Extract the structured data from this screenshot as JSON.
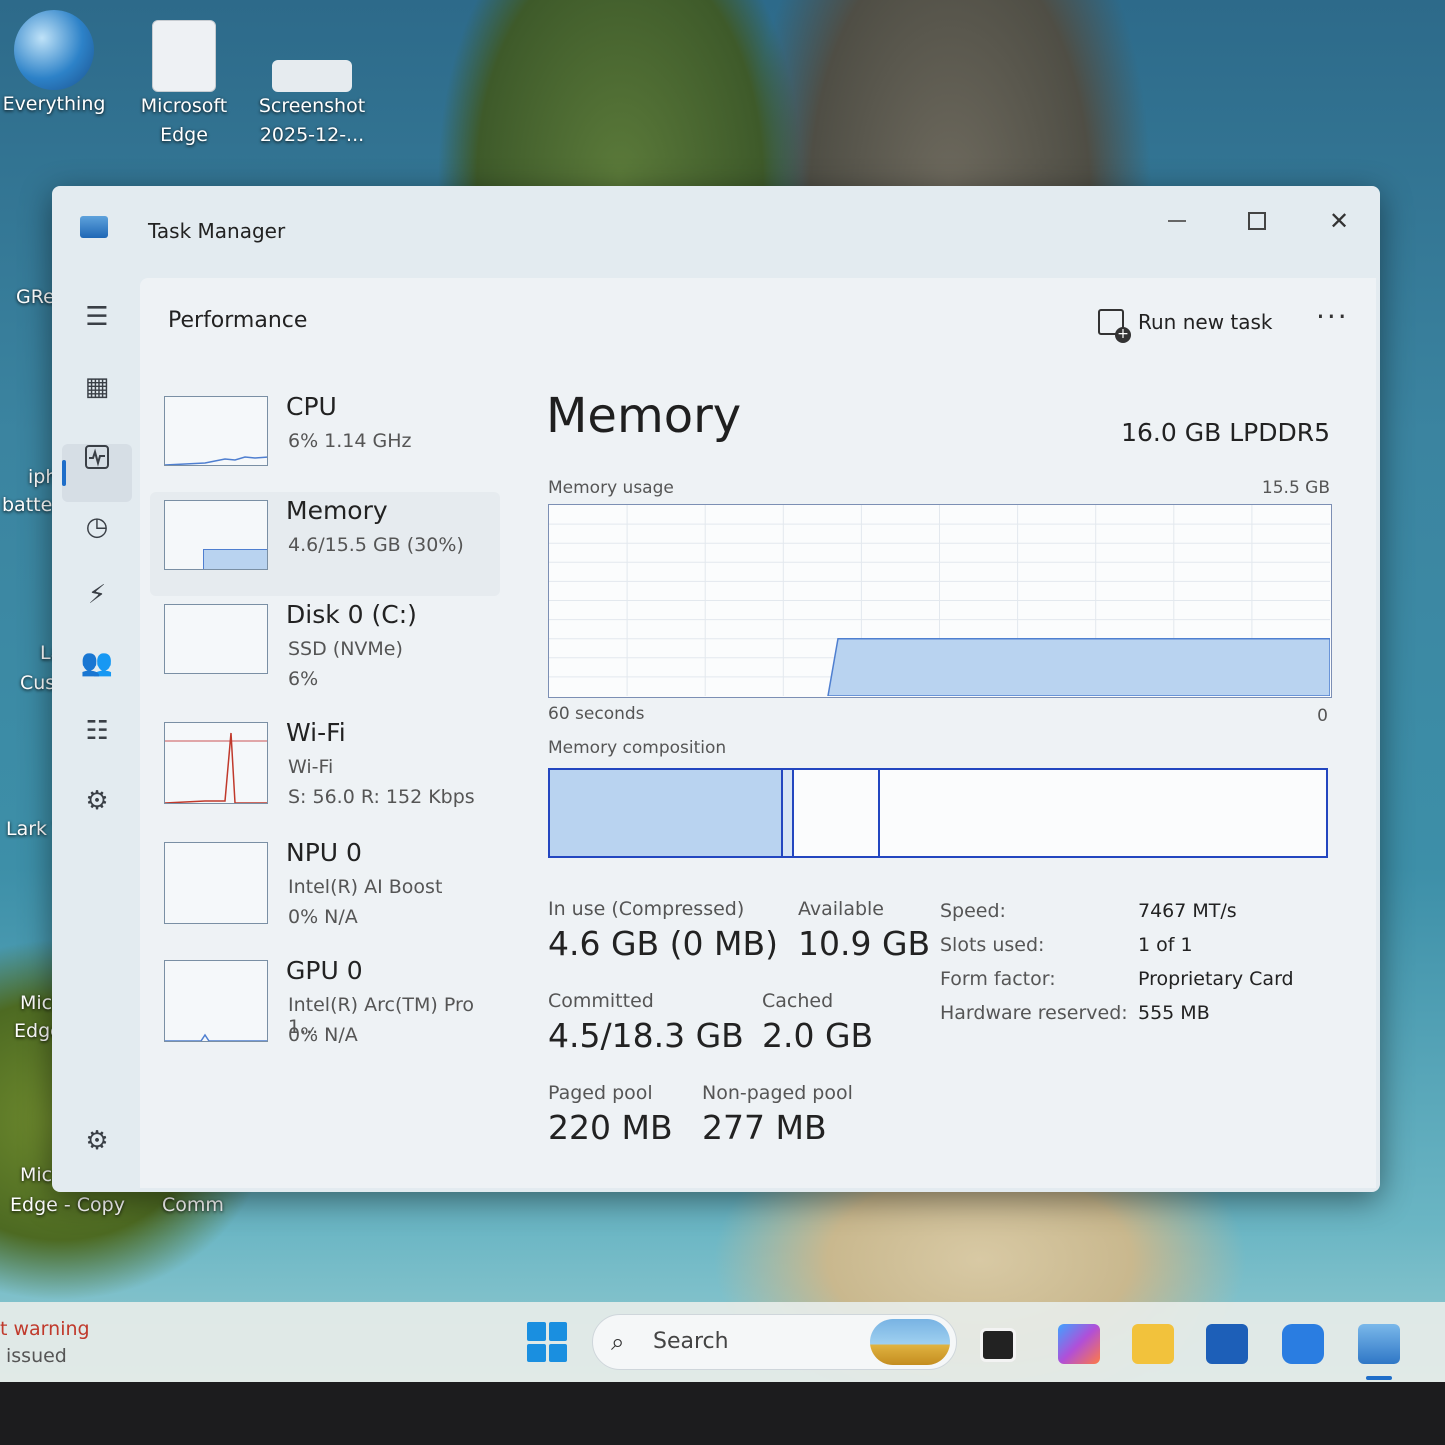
{
  "desktop": {
    "icons": [
      {
        "label": "Everything"
      },
      {
        "label": "Microsoft\nEdge"
      },
      {
        "label": "Screenshot\n2025-12-..."
      }
    ],
    "side_labels": [
      "GRe",
      "iph",
      "batter",
      "La",
      "Cust",
      "Lark T",
      "Micr",
      "Edge",
      "Micr",
      "Edge - Copy",
      "Comm"
    ]
  },
  "window": {
    "title": "Task Manager",
    "header": "Performance",
    "run_new_task": "Run new task",
    "more": "···"
  },
  "devices": [
    {
      "name": "CPU",
      "sub1": "6%  1.14 GHz",
      "sub2": ""
    },
    {
      "name": "Memory",
      "sub1": "4.6/15.5 GB (30%)",
      "sub2": ""
    },
    {
      "name": "Disk 0 (C:)",
      "sub1": "SSD (NVMe)",
      "sub2": "6%"
    },
    {
      "name": "Wi-Fi",
      "sub1": "Wi-Fi",
      "sub2": "S: 56.0  R: 152 Kbps"
    },
    {
      "name": "NPU 0",
      "sub1": "Intel(R) AI Boost",
      "sub2": "0%  N/A"
    },
    {
      "name": "GPU 0",
      "sub1": "Intel(R) Arc(TM) Pro 1...",
      "sub2": "0%  N/A"
    }
  ],
  "memory": {
    "title": "Memory",
    "spec": "16.0 GB LPDDR5",
    "usage_label": "Memory usage",
    "usage_max": "15.5 GB",
    "time_left": "60 seconds",
    "time_right": "0",
    "composition_label": "Memory composition",
    "usage_level": 0.3,
    "composition": {
      "in_use": 0.3,
      "modified": 0.015,
      "standby": 0.11
    },
    "stats": {
      "in_use_label": "In use (Compressed)",
      "in_use": "4.6 GB (0 MB)",
      "available_label": "Available",
      "available": "10.9 GB",
      "committed_label": "Committed",
      "committed": "4.5/18.3 GB",
      "cached_label": "Cached",
      "cached": "2.0 GB",
      "paged_label": "Paged pool",
      "paged": "220 MB",
      "nonpaged_label": "Non-paged pool",
      "nonpaged": "277 MB"
    },
    "details": [
      {
        "k": "Speed:",
        "v": "7467 MT/s"
      },
      {
        "k": "Slots used:",
        "v": "1 of 1"
      },
      {
        "k": "Form factor:",
        "v": "Proprietary Card"
      },
      {
        "k": "Hardware reserved:",
        "v": "555 MB"
      }
    ]
  },
  "taskbar": {
    "warning_line1": "t warning",
    "warning_line2": "issued",
    "search_placeholder": "Search"
  },
  "colors": {
    "accent": "#1f6ec9",
    "graph_fill": "#b9d3f0",
    "graph_line": "#4f7fd0",
    "comp_border": "#2346c0"
  }
}
